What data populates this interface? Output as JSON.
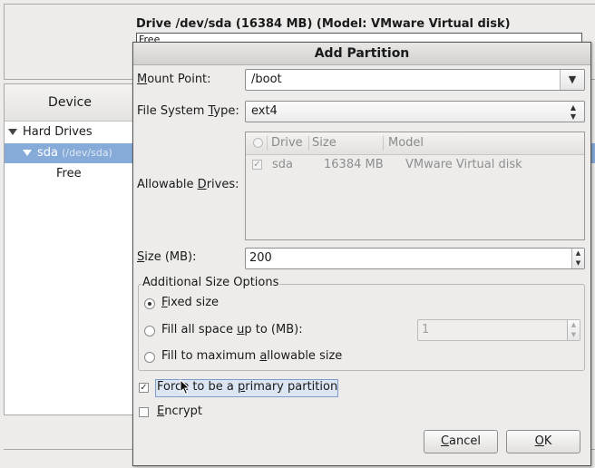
{
  "background": {
    "drive_title": "Drive /dev/sda (16384 MB) (Model: VMware Virtual disk)",
    "drive_bar_text": "Free",
    "tree_header": "Device",
    "tree": {
      "hard_drives": "Hard Drives",
      "sda": "sda",
      "sda_path": "(/dev/sda)",
      "free": "Free"
    }
  },
  "dialog": {
    "title": "Add Partition",
    "mount_point": {
      "label_pre": "",
      "label_ul": "M",
      "label_post": "ount Point:",
      "value": "/boot"
    },
    "fs_type": {
      "label_pre": "File System ",
      "label_ul": "T",
      "label_post": "ype:",
      "value": "ext4"
    },
    "allowable_drives": {
      "label_pre": "Allowable ",
      "label_ul": "D",
      "label_post": "rives:",
      "columns": [
        "Drive",
        "Size",
        "Model"
      ],
      "rows": [
        {
          "drive": "sda",
          "size": "16384 MB",
          "model": "VMware Virtual disk",
          "checked": true
        }
      ]
    },
    "size": {
      "label_pre": "",
      "label_ul": "S",
      "label_post": "ize (MB):",
      "value": "200"
    },
    "additional_size": {
      "legend": "Additional Size Options",
      "fixed_pre": "",
      "fixed_ul": "F",
      "fixed_post": "ixed size",
      "fill_pre": "Fill all space ",
      "fill_ul": "u",
      "fill_post": "p to (MB):",
      "fill_value": "1",
      "max_pre": "Fill to maximum ",
      "max_ul": "a",
      "max_post": "llowable size",
      "selected": "fixed"
    },
    "primary": {
      "pre": "Forc",
      "mid": "e to be a ",
      "ul": "p",
      "post": "rimary partition",
      "checked": true
    },
    "encrypt": {
      "pre": "",
      "ul": "E",
      "post": "ncrypt",
      "checked": false
    },
    "buttons": {
      "cancel_ul": "C",
      "cancel_post": "ancel",
      "ok_ul": "O",
      "ok_post": "K"
    }
  }
}
